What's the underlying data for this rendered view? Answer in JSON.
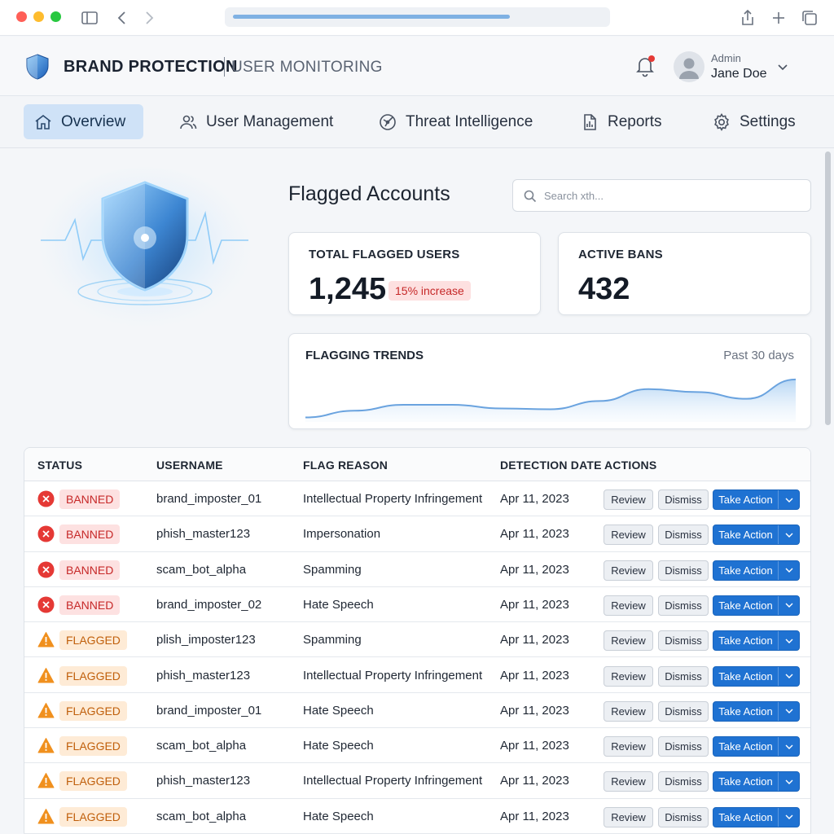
{
  "brand": {
    "title": "BRAND PROTECTION",
    "subtitle": "USER MONITORING"
  },
  "user": {
    "role": "Admin",
    "name": "Jane Doe"
  },
  "nav": [
    {
      "label": "Overview",
      "icon": "home-icon",
      "active": true
    },
    {
      "label": "User Management",
      "icon": "users-icon",
      "active": false
    },
    {
      "label": "Threat Intelligence",
      "icon": "radar-icon",
      "active": false
    },
    {
      "label": "Reports",
      "icon": "report-icon",
      "active": false
    },
    {
      "label": "Settings",
      "icon": "gear-icon",
      "active": false
    }
  ],
  "main": {
    "title": "Flagged Accounts",
    "search_placeholder": "Search xth..."
  },
  "stats": {
    "total_label": "TOTAL FLAGGED USERS",
    "total_value": "1,245",
    "total_change": "15% increase",
    "bans_label": "ACTIVE BANS",
    "bans_value": "432"
  },
  "trend": {
    "label": "FLAGGING TRENDS",
    "range": "Past 30 days"
  },
  "chart_data": {
    "type": "area",
    "title": "FLAGGING TRENDS",
    "x": [
      0,
      1,
      2,
      3,
      4,
      5,
      6,
      7,
      8,
      9,
      10
    ],
    "values": [
      6,
      15,
      23,
      23,
      18,
      17,
      28,
      44,
      40,
      31,
      57
    ],
    "ylim": [
      0,
      70
    ],
    "grid": false,
    "color": "#6aa3df"
  },
  "table": {
    "columns": [
      "STATUS",
      "USERNAME",
      "FLAG REASON",
      "DETECTION DATE",
      "ACTIONS"
    ],
    "actions": {
      "review": "Review",
      "dismiss": "Dismiss",
      "take_action": "Take Action"
    },
    "rows": [
      {
        "status": "BANNED",
        "username": "brand_imposter_01",
        "reason": "Intellectual Property Infringement",
        "date": "Apr 11, 2023"
      },
      {
        "status": "BANNED",
        "username": "phish_master123",
        "reason": "Impersonation",
        "date": "Apr 11, 2023"
      },
      {
        "status": "BANNED",
        "username": "scam_bot_alpha",
        "reason": "Spamming",
        "date": "Apr 11, 2023"
      },
      {
        "status": "BANNED",
        "username": "brand_imposter_02",
        "reason": "Hate Speech",
        "date": "Apr 11, 2023"
      },
      {
        "status": "FLAGGED",
        "username": "plish_imposter123",
        "reason": "Spamming",
        "date": "Apr 11, 2023"
      },
      {
        "status": "FLAGGED",
        "username": "phish_master123",
        "reason": "Intellectual Property Infringement",
        "date": "Apr 11, 2023"
      },
      {
        "status": "FLAGGED",
        "username": "brand_imposter_01",
        "reason": "Hate Speech",
        "date": "Apr 11, 2023"
      },
      {
        "status": "FLAGGED",
        "username": "scam_bot_alpha",
        "reason": "Hate Speech",
        "date": "Apr 11, 2023"
      },
      {
        "status": "FLAGGED",
        "username": "phish_master123",
        "reason": "Intellectual Property Infringement",
        "date": "Apr 11, 2023"
      },
      {
        "status": "FLAGGED",
        "username": "scam_bot_alpha",
        "reason": "Hate Speech",
        "date": "Apr 11, 2023"
      }
    ]
  },
  "colors": {
    "accent": "#1f72d2",
    "banned": "#e53935",
    "flagged": "#f0901e",
    "nav_active": "#cfe2f7"
  },
  "browser": {
    "load_progress": 0.75
  }
}
